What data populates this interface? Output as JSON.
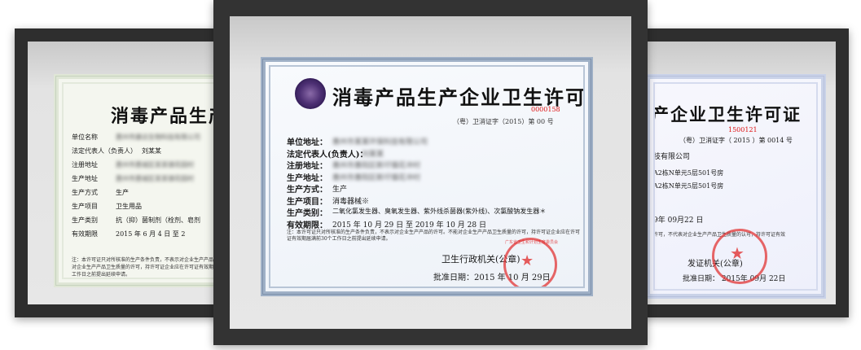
{
  "left_cert": {
    "title": "消毒产品生产企",
    "rows": [
      {
        "label": "单位名称",
        "value": "惠州市康达生物科技有限公司"
      },
      {
        "label": "法定代表人（负责人）",
        "value": "刘某某"
      },
      {
        "label": "注册地址",
        "value": "惠州市惠城区某某镇花园村"
      },
      {
        "label": "生产地址",
        "value": "惠州市惠城区某某镇花园村"
      },
      {
        "label": "生产方式",
        "value": "生产"
      },
      {
        "label": "生产项目",
        "value": "卫生用品"
      },
      {
        "label": "生产类别",
        "value": "抗（抑）菌制剂（栓剂、皂剂"
      },
      {
        "label": "有效期限",
        "value": "2015  年  6  月  4  日  至  2"
      }
    ],
    "note": "注：本许可证只对所核准的生产条件负责，不表示对企业生产产品的许可。不能对企业生产产品卫生质量的许可，持许可证企业应在许可证有效期届满前30个工作日之前提出延续申请。"
  },
  "center_cert": {
    "title": "消毒产品生产企业卫生许可证",
    "serial": "0000158",
    "license_no": "（粤）卫消证字（2015）第 00 号",
    "rows": [
      {
        "label": "单位地址：",
        "value": "惠州市某某环保科技有限公司"
      },
      {
        "label": "法定代表人(负责人)：",
        "value": "刘某某"
      },
      {
        "label": "注册地址：",
        "value": "惠州市惠阳区新圩镇花冲村"
      },
      {
        "label": "生产地址：",
        "value": "惠州市惠阳区新圩镇花冲村"
      },
      {
        "label": "生产方式：",
        "value": "生产"
      },
      {
        "label": "生产项目：",
        "value": "消毒器械※"
      },
      {
        "label": "生产类别：",
        "value": "二氧化氯发生器、臭氧发生器、紫外线杀菌器(紫外线)、次氯酸钠发生器＊"
      },
      {
        "label": "有效期限：",
        "value": "2015 年 10 月 29 日  至 2019 年 10 月 28 日"
      }
    ],
    "note": "注：本许可证只对所核准的生产条件负责，不表示对企业生产产品的许可。不能对企业生产产品卫生质量的许可，持许可证企业应在许可证有效期届满前30个工作日之前提出延续申请。",
    "issuer": "卫生行政机关(公章)",
    "approval_date": "批准日期：2015 年 10 月 29日",
    "seal_text": "广东省卫生和计划生育委员会"
  },
  "right_cert": {
    "title": "产企业卫生许可证",
    "serial": "1500121",
    "license_no": "（粤）卫消证字（ 2015 ）第 0014 号",
    "rows": [
      {
        "value": "技有限公司"
      },
      {
        "value": "A2栋N单元5层501号房"
      },
      {
        "value": "A2栋N单元5层501号房"
      }
    ],
    "validity": "9年  09月22  日",
    "note": "许可，不代表对企业生产产品卫生质量的认可，持许可证有效",
    "issuer": "发证机关(公章)",
    "approval_date": "批准日期：  2015年  09月  22日"
  }
}
